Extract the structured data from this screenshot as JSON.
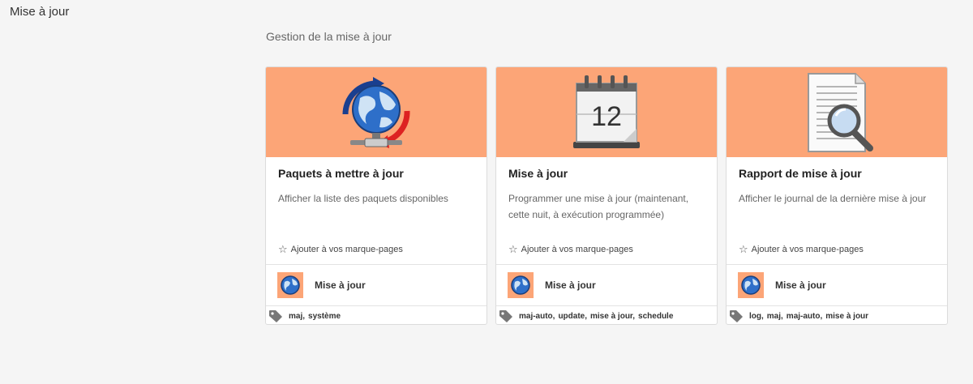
{
  "page": {
    "title": "Mise à jour"
  },
  "section": {
    "title": "Gestion de la mise à jour"
  },
  "cards": [
    {
      "title": "Paquets à mettre à jour",
      "description": "Afficher la liste des paquets disponibles",
      "bookmark_label": "Ajouter à vos marque-pages",
      "app_label": "Mise à jour",
      "tags": [
        "maj,",
        "système"
      ],
      "icon": "globe-update-icon"
    },
    {
      "title": "Mise à jour",
      "description": "Programmer une mise à jour (maintenant, cette nuit, à exécution programmée)",
      "bookmark_label": "Ajouter à vos marque-pages",
      "app_label": "Mise à jour",
      "calendar_day": "12",
      "tags": [
        "maj-auto,",
        "update,",
        "mise à jour,",
        "schedule"
      ],
      "icon": "calendar-icon"
    },
    {
      "title": "Rapport de mise à jour",
      "description": "Afficher le journal de la dernière mise à jour",
      "bookmark_label": "Ajouter à vos marque-pages",
      "app_label": "Mise à jour",
      "tags": [
        "log,",
        "maj,",
        "maj-auto,",
        "mise à jour"
      ],
      "icon": "document-search-icon"
    }
  ],
  "colors": {
    "banner": "#fca577",
    "background": "#f5f5f5"
  }
}
